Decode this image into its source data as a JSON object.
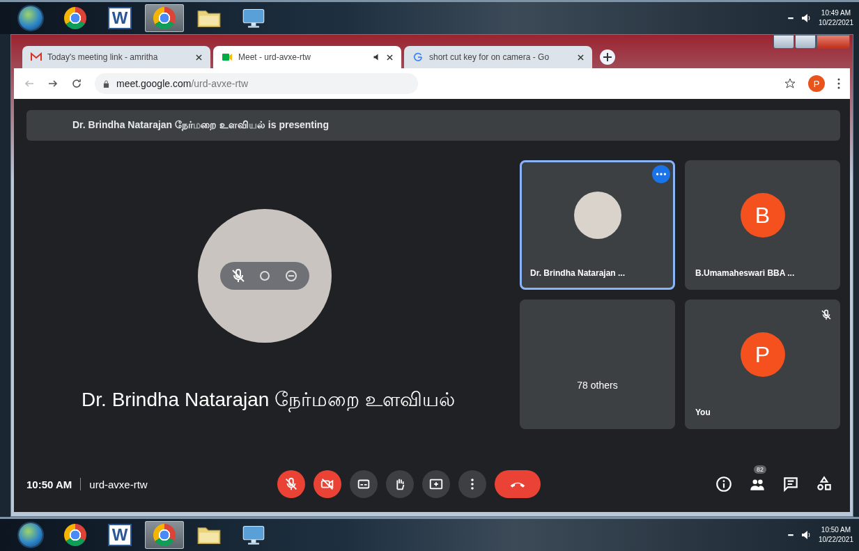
{
  "taskbar_top": {
    "apps": [
      {
        "kind": "start",
        "selected": false
      },
      {
        "kind": "chrome",
        "selected": false
      },
      {
        "kind": "word",
        "label": "W",
        "selected": false
      },
      {
        "kind": "chrome",
        "selected": true
      },
      {
        "kind": "folder",
        "selected": false
      },
      {
        "kind": "network",
        "selected": false
      }
    ],
    "clock": {
      "time": "10:49 AM",
      "date": "10/22/2021"
    }
  },
  "browser": {
    "tabs": [
      {
        "kind": "gmail",
        "title": "Today's meeting link - amritha",
        "selected": false,
        "audio": false
      },
      {
        "kind": "meet",
        "title": "Meet - urd-avxe-rtw",
        "selected": true,
        "audio": true
      },
      {
        "kind": "google",
        "title": "short cut key for on camera - Go",
        "selected": false,
        "audio": false
      }
    ],
    "address": {
      "domain": "meet.google.com",
      "path": "/urd-avxe-rtw"
    },
    "profile_initial": "P"
  },
  "meet": {
    "banner": "Dr. Brindha Natarajan நேர்மறை உளவியல் is presenting",
    "presenter_name": "Dr. Brindha Natarajan நேர்மறை உளவியல்",
    "tiles": [
      {
        "kind": "photo",
        "name": "Dr. Brindha Natarajan ...",
        "selected": true,
        "muted": false
      },
      {
        "kind": "initial",
        "initial": "B",
        "name": "B.Umamaheswari BBA ...",
        "selected": false,
        "muted": false
      },
      {
        "kind": "others",
        "name": "78 others",
        "selected": false,
        "muted": false
      },
      {
        "kind": "initial",
        "initial": "P",
        "name": "You",
        "selected": false,
        "muted": true
      }
    ],
    "time": "10:50 AM",
    "meeting_code": "urd-avxe-rtw",
    "controls": [
      {
        "kind": "mic",
        "off": true
      },
      {
        "kind": "camera",
        "off": true
      },
      {
        "kind": "captions",
        "off": false
      },
      {
        "kind": "hand",
        "off": false
      },
      {
        "kind": "present",
        "off": false
      },
      {
        "kind": "more",
        "off": false
      },
      {
        "kind": "hangup"
      }
    ],
    "side_controls": [
      {
        "kind": "info"
      },
      {
        "kind": "people",
        "badge": "82"
      },
      {
        "kind": "chat"
      },
      {
        "kind": "activities"
      }
    ]
  },
  "taskbar_bottom": {
    "apps": [
      {
        "kind": "start",
        "selected": false
      },
      {
        "kind": "chrome",
        "selected": false
      },
      {
        "kind": "word",
        "label": "W",
        "selected": false
      },
      {
        "kind": "chrome",
        "selected": true
      },
      {
        "kind": "folder",
        "selected": false
      },
      {
        "kind": "network",
        "selected": false
      }
    ],
    "clock": {
      "time": "10:50 AM",
      "date": "10/22/2021"
    }
  }
}
